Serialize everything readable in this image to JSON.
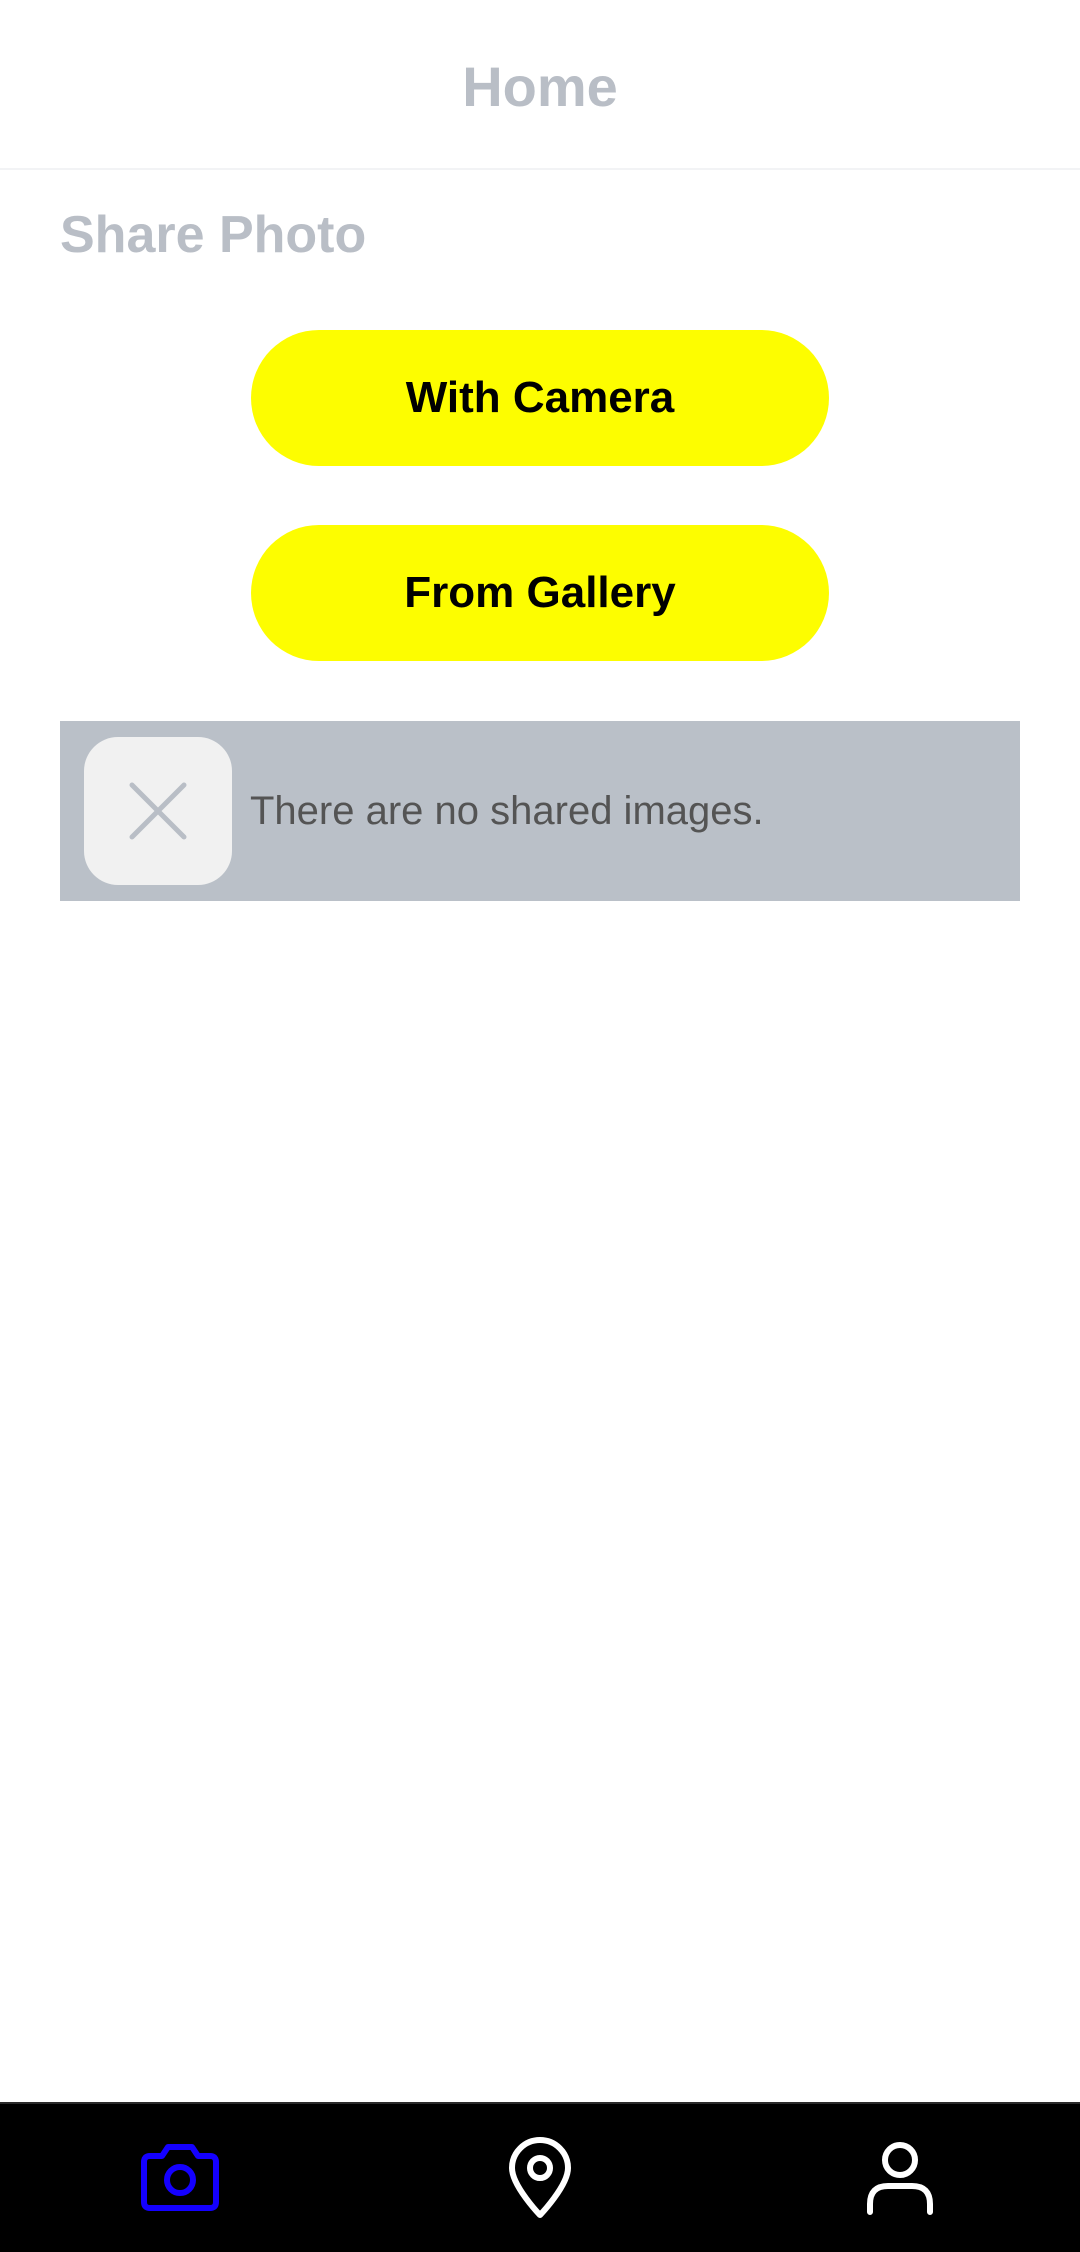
{
  "header": {
    "title": "Home"
  },
  "share": {
    "title": "Share Photo",
    "camera_label": "With Camera",
    "gallery_label": "From Gallery"
  },
  "empty_state": {
    "icon": "close-icon",
    "message": "There are no shared images."
  },
  "bottom_nav": {
    "items": [
      {
        "icon": "camera-icon",
        "active": true
      },
      {
        "icon": "map-pin-icon",
        "active": false
      },
      {
        "icon": "user-icon",
        "active": false
      }
    ]
  },
  "colors": {
    "button_yellow": "#fdfd00",
    "title_gray": "#b9bec6",
    "card_gray": "#bac0c8",
    "nav_active": "#1400ff",
    "nav_inactive": "#ffffff",
    "nav_background": "#000000"
  }
}
